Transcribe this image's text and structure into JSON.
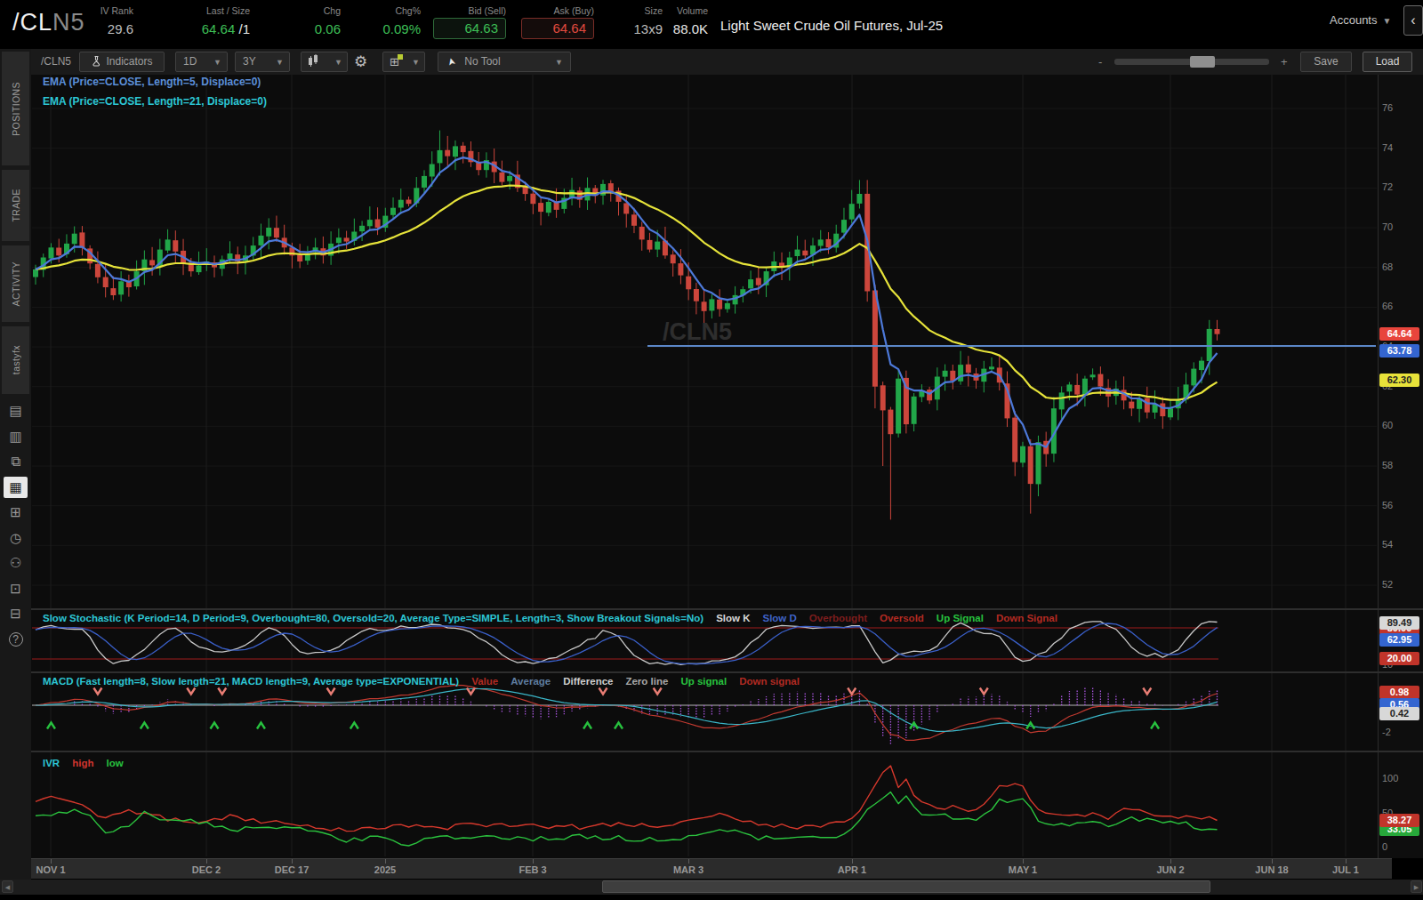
{
  "header": {
    "symbol_prefix": "/CL",
    "symbol_suffix": "N5",
    "iv_rank": {
      "label": "IV Rank",
      "value": "29.6"
    },
    "last_size": {
      "label": "Last / Size",
      "value": "64.64",
      "size": " /1"
    },
    "chg": {
      "label": "Chg",
      "value": "0.06"
    },
    "chg_pct": {
      "label": "Chg%",
      "value": "0.09%"
    },
    "bid": {
      "label": "Bid (Sell)",
      "value": "64.63"
    },
    "ask": {
      "label": "Ask (Buy)",
      "value": "64.64"
    },
    "size": {
      "label": "Size",
      "value": "13x9"
    },
    "volume": {
      "label": "Volume",
      "value": "88.0K"
    },
    "description": "Light Sweet Crude Oil Futures, Jul-25",
    "accounts_label": "Accounts",
    "back_glyph": "‹"
  },
  "sidebar": {
    "tabs": [
      "POSITIONS",
      "TRADE",
      "ACTIVITY",
      "tastyfx"
    ],
    "icons": [
      {
        "name": "news-icon",
        "glyph": "▤"
      },
      {
        "name": "watchlist-icon",
        "glyph": "▥"
      },
      {
        "name": "monitor-icon",
        "glyph": "⧉"
      },
      {
        "name": "chart-icon",
        "glyph": "▦",
        "active": true
      },
      {
        "name": "grid-icon",
        "glyph": "⊞"
      },
      {
        "name": "history-icon",
        "glyph": "◷"
      },
      {
        "name": "community-icon",
        "glyph": "⚇"
      },
      {
        "name": "calendar-icon",
        "glyph": "⊡"
      },
      {
        "name": "fx-icon",
        "glyph": "⊟"
      },
      {
        "name": "help-icon",
        "glyph": "?"
      }
    ]
  },
  "toolbar": {
    "symbol": "/CLN5",
    "indicators": "Indicators",
    "timeframe": "1D",
    "range": "3Y",
    "tool": "No Tool",
    "save": "Save",
    "load": "Load",
    "zoom_minus": "-",
    "zoom_plus": "+"
  },
  "chart": {
    "ema_labels": [
      {
        "text": "EMA (Price=CLOSE, Length=5, Displace=0)",
        "color": "#5b8fd9"
      },
      {
        "text": "EMA (Price=CLOSE, Length=21, Displace=0)",
        "color": "#2cc6d4"
      }
    ],
    "watermark": "/CLN5",
    "price_ticks": [
      76,
      74,
      72,
      70,
      68,
      66,
      64,
      62,
      60,
      58,
      56,
      54,
      52
    ],
    "price_tags": [
      {
        "text": "63.78",
        "value": 63.78,
        "bg": "#3465d0",
        "fg": "#fff"
      },
      {
        "text": "64.64",
        "value": 64.64,
        "bg": "#e8453c",
        "fg": "#fff"
      },
      {
        "text": "62.30",
        "value": 62.3,
        "bg": "#e8e23a",
        "fg": "#222"
      }
    ],
    "stoch_panel": {
      "label": "Slow Stochastic (K Period=14, D Period=9, Overbought=80, Oversold=20, Average Type=SIMPLE, Length=3, Show Breakout Signals=No)",
      "legend": [
        {
          "t": "Slow K",
          "c": "#d8d8d8"
        },
        {
          "t": "Slow D",
          "c": "#3f63c8"
        },
        {
          "t": "Overbought",
          "c": "#7c1d1d"
        },
        {
          "t": "Oversold",
          "c": "#b22a22"
        },
        {
          "t": "Up Signal",
          "c": "#27c13e"
        },
        {
          "t": "Down Signal",
          "c": "#b22a22"
        }
      ],
      "tags": [
        {
          "text": "80.00",
          "value": 80,
          "bg": "#c0342a",
          "fg": "#fff",
          "dy": 0
        },
        {
          "text": "89.49",
          "value": 89.49,
          "bg": "#d8d8d8",
          "fg": "#222",
          "dy": 0
        },
        {
          "text": "62.95",
          "value": 62.95,
          "bg": "#3465d0",
          "fg": "#fff",
          "dy": 4
        },
        {
          "text": "20.00",
          "value": 20,
          "bg": "#c0342a",
          "fg": "#fff",
          "dy": 0
        }
      ],
      "axis_extra": [
        {
          "text": "10",
          "value": 10
        }
      ]
    },
    "macd_panel": {
      "label": "MACD (Fast length=8, Slow length=21, MACD length=9, Average type=EXPONENTIAL)",
      "legend": [
        {
          "t": "Value",
          "c": "#b22a22"
        },
        {
          "t": "Average",
          "c": "#5f7da0"
        },
        {
          "t": "Difference",
          "c": "#cfcfcf"
        },
        {
          "t": "Zero line",
          "c": "#a8a8a8"
        },
        {
          "t": "Up signal",
          "c": "#27c13e"
        },
        {
          "t": "Down signal",
          "c": "#b22a22"
        }
      ],
      "tags": [
        {
          "text": "0.98",
          "value": 0.98,
          "bg": "#c0342a",
          "fg": "#fff",
          "dy": 0
        },
        {
          "text": "0.56",
          "value": 0.56,
          "bg": "#3465d0",
          "fg": "#fff",
          "dy": 8
        },
        {
          "text": "0.42",
          "value": 0.42,
          "bg": "#d8d8d8",
          "fg": "#222",
          "dy": 16
        }
      ],
      "axis_extra": [
        {
          "text": "-2",
          "value": -2
        }
      ]
    },
    "ivr_panel": {
      "label": "IVR",
      "legend": [
        {
          "t": "high",
          "c": "#d0352f"
        },
        {
          "t": "low",
          "c": "#27c13e"
        }
      ],
      "tags": [
        {
          "text": "33.05",
          "value": 33.05,
          "bg": "#27a83a",
          "fg": "#fff",
          "dy": 6
        },
        {
          "text": "38.27",
          "value": 38.27,
          "bg": "#c0342a",
          "fg": "#fff",
          "dy": 0
        }
      ],
      "axis_extra": [
        {
          "text": "100",
          "value": 100
        },
        {
          "text": "50",
          "value": 50
        },
        {
          "text": "0",
          "value": 0
        }
      ]
    }
  },
  "chart_data": {
    "type": "candlestick",
    "symbol": "/CLN5",
    "interval": "1D",
    "range": "3Y",
    "ylim": [
      51,
      77.8
    ],
    "closes": [
      67.9,
      68.5,
      69.0,
      68.6,
      69.2,
      69.7,
      69.0,
      68.2,
      67.5,
      67.0,
      66.6,
      67.3,
      67.0,
      67.8,
      68.4,
      68.1,
      68.9,
      69.4,
      68.8,
      68.2,
      67.8,
      68.1,
      68.3,
      68.0,
      68.4,
      68.7,
      68.3,
      68.6,
      69.1,
      69.6,
      70.0,
      69.5,
      69.0,
      68.6,
      68.3,
      68.7,
      69.0,
      68.6,
      69.2,
      69.5,
      69.3,
      69.8,
      70.1,
      70.4,
      70.0,
      70.6,
      71.0,
      71.4,
      71.2,
      72.0,
      72.6,
      73.2,
      73.9,
      73.6,
      74.1,
      73.8,
      73.3,
      72.9,
      73.4,
      72.8,
      72.3,
      72.6,
      72.0,
      71.7,
      71.2,
      70.8,
      71.3,
      70.9,
      71.5,
      71.9,
      71.4,
      72.0,
      71.6,
      72.2,
      71.8,
      71.3,
      70.7,
      70.1,
      69.4,
      68.9,
      69.3,
      68.6,
      68.2,
      67.6,
      66.9,
      66.3,
      65.8,
      66.4,
      65.9,
      66.2,
      66.6,
      66.9,
      67.4,
      67.1,
      67.8,
      68.3,
      68.0,
      68.5,
      68.9,
      68.6,
      69.1,
      69.4,
      69.0,
      69.7,
      70.4,
      71.2,
      71.7,
      66.8,
      62.0,
      60.8,
      59.6,
      62.4,
      60.1,
      61.5,
      61.8,
      61.3,
      62.5,
      62.8,
      62.3,
      63.1,
      62.7,
      62.3,
      62.9,
      63.0,
      62.2,
      60.4,
      58.2,
      59.0,
      57.1,
      59.2,
      58.6,
      60.9,
      61.7,
      62.1,
      61.6,
      62.4,
      62.6,
      62.0,
      61.5,
      61.9,
      61.3,
      60.9,
      61.4,
      60.7,
      61.1,
      60.5,
      60.9,
      61.3,
      62.1,
      62.9,
      63.3,
      64.9,
      64.64
    ],
    "wick_overrides": {
      "52": {
        "high": 74.9
      },
      "106": {
        "high": 72.4
      },
      "108": {
        "low": 60.9
      },
      "109": {
        "low": 58.0
      },
      "110": {
        "low": 55.3
      },
      "128": {
        "low": 55.6
      },
      "152": {
        "high": 65.35
      }
    },
    "horizontal_line": 64.05,
    "ema_periods": [
      5,
      21
    ],
    "stochastic": {
      "k_period": 14,
      "d_period": 9,
      "length": 3,
      "overbought": 80,
      "oversold": 20
    },
    "macd": {
      "fast": 8,
      "slow": 21,
      "signal": 9
    },
    "up_signals": [
      2,
      14,
      23,
      29,
      41,
      71,
      75,
      113,
      128,
      144
    ],
    "down_signals": [
      8,
      20,
      24,
      38,
      56,
      73,
      80,
      105,
      122,
      143
    ],
    "ivr_red_anchors": [
      [
        0,
        65
      ],
      [
        2,
        70
      ],
      [
        6,
        58
      ],
      [
        9,
        42
      ],
      [
        12,
        51
      ],
      [
        17,
        40
      ],
      [
        22,
        36
      ],
      [
        25,
        45
      ],
      [
        28,
        40
      ],
      [
        34,
        29
      ],
      [
        40,
        26
      ],
      [
        46,
        30
      ],
      [
        52,
        28
      ],
      [
        58,
        32
      ],
      [
        64,
        30
      ],
      [
        70,
        28
      ],
      [
        76,
        33
      ],
      [
        82,
        30
      ],
      [
        88,
        45
      ],
      [
        92,
        35
      ],
      [
        96,
        30
      ],
      [
        100,
        28
      ],
      [
        104,
        35
      ],
      [
        106,
        55
      ],
      [
        108,
        90
      ],
      [
        110,
        120
      ],
      [
        111,
        88
      ],
      [
        112,
        95
      ],
      [
        114,
        62
      ],
      [
        116,
        58
      ],
      [
        119,
        57
      ],
      [
        121,
        52
      ],
      [
        124,
        88
      ],
      [
        127,
        88
      ],
      [
        129,
        55
      ],
      [
        132,
        45
      ],
      [
        135,
        47
      ],
      [
        138,
        43
      ],
      [
        141,
        58
      ],
      [
        144,
        48
      ],
      [
        147,
        45
      ],
      [
        150,
        42
      ],
      [
        152,
        38.3
      ]
    ],
    "ivr_green_anchors": [
      [
        0,
        45
      ],
      [
        2,
        48
      ],
      [
        6,
        52
      ],
      [
        9,
        22
      ],
      [
        12,
        33
      ],
      [
        14,
        52
      ],
      [
        17,
        38
      ],
      [
        22,
        35
      ],
      [
        25,
        22
      ],
      [
        28,
        30
      ],
      [
        34,
        24
      ],
      [
        40,
        9
      ],
      [
        44,
        12
      ],
      [
        48,
        5
      ],
      [
        52,
        12
      ],
      [
        58,
        15
      ],
      [
        64,
        12
      ],
      [
        70,
        15
      ],
      [
        76,
        12
      ],
      [
        82,
        10
      ],
      [
        88,
        28
      ],
      [
        92,
        15
      ],
      [
        96,
        10
      ],
      [
        100,
        12
      ],
      [
        104,
        15
      ],
      [
        106,
        38
      ],
      [
        108,
        65
      ],
      [
        110,
        80
      ],
      [
        111,
        62
      ],
      [
        112,
        76
      ],
      [
        114,
        45
      ],
      [
        116,
        45
      ],
      [
        119,
        42
      ],
      [
        121,
        38
      ],
      [
        124,
        67
      ],
      [
        127,
        67
      ],
      [
        129,
        40
      ],
      [
        132,
        32
      ],
      [
        135,
        35
      ],
      [
        138,
        30
      ],
      [
        141,
        42
      ],
      [
        144,
        35
      ],
      [
        147,
        37
      ],
      [
        150,
        28
      ],
      [
        152,
        25
      ]
    ],
    "x_axis_labels": [
      {
        "t": "NOV 1",
        "x": 57
      },
      {
        "t": "DEC 2",
        "x": 232
      },
      {
        "t": "DEC 17",
        "x": 328
      },
      {
        "t": "2025",
        "x": 433
      },
      {
        "t": "FEB 3",
        "x": 599
      },
      {
        "t": "MAR 3",
        "x": 774
      },
      {
        "t": "APR 1",
        "x": 958
      },
      {
        "t": "MAY 1",
        "x": 1150
      },
      {
        "t": "JUN 2",
        "x": 1316
      },
      {
        "t": "JUN 18",
        "x": 1430
      },
      {
        "t": "JUL 1",
        "x": 1513
      }
    ]
  }
}
